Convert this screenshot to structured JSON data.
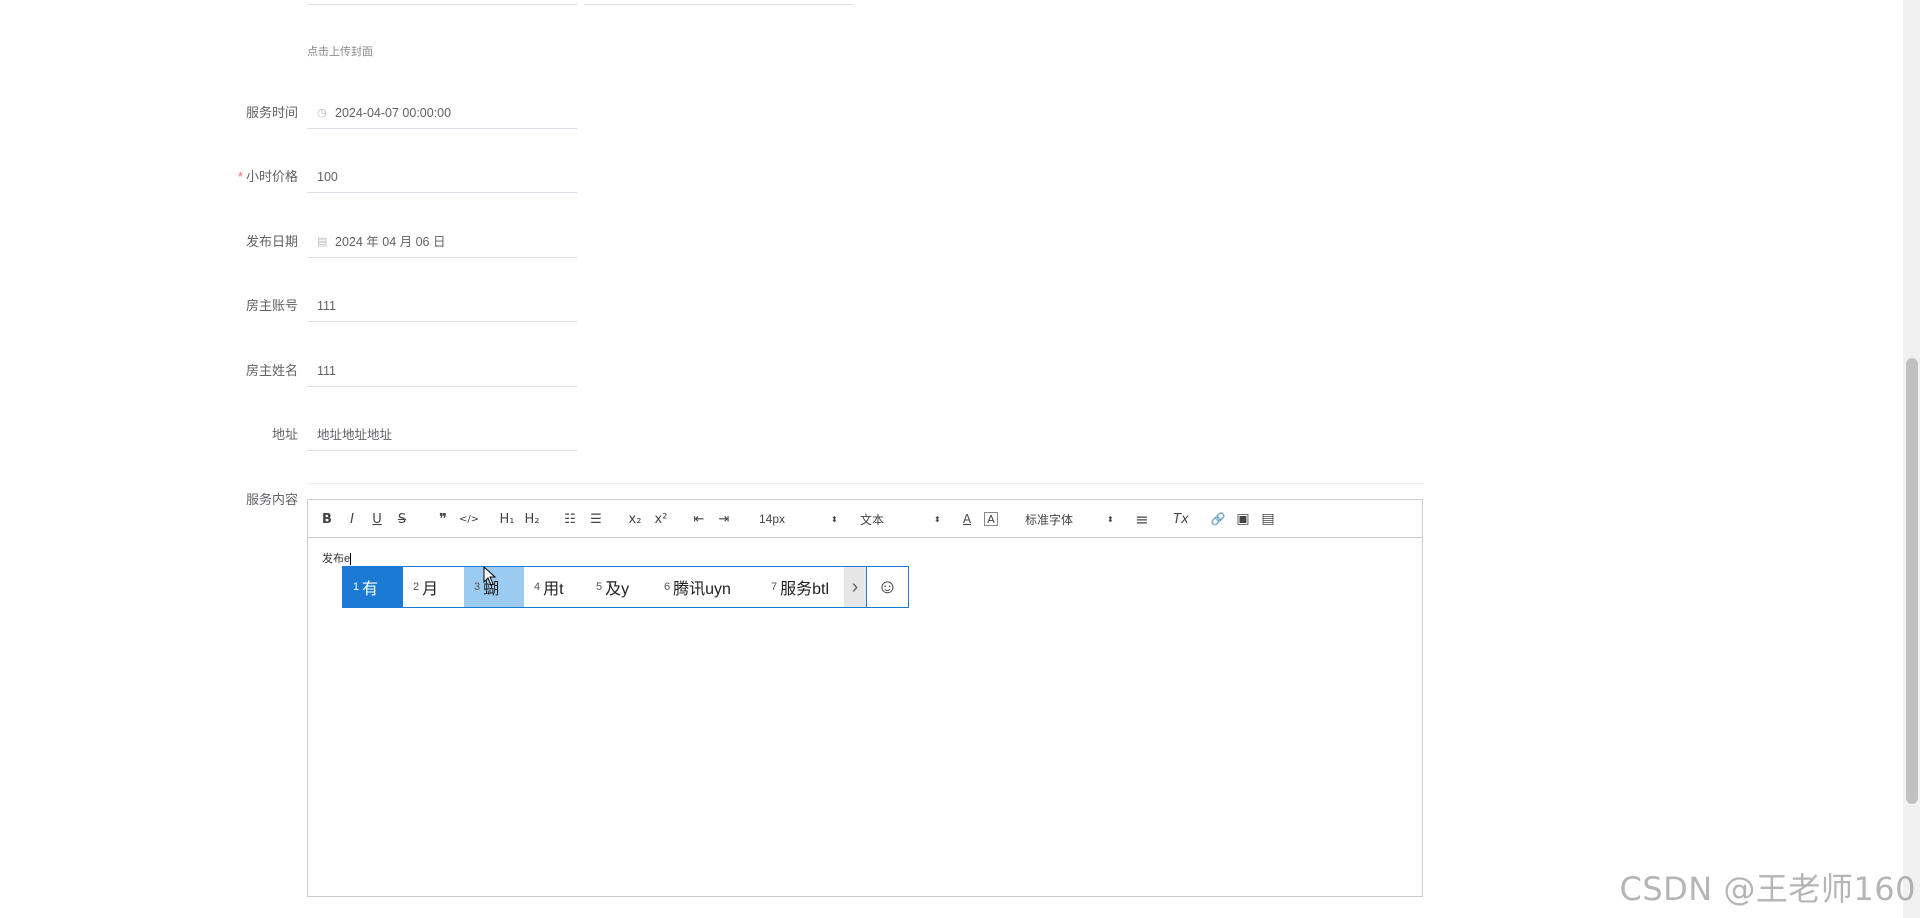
{
  "upload_hint": "点击上传封面",
  "fields": {
    "service_time": {
      "label": "服务时间",
      "value": "2024-04-07 00:00:00",
      "icon": "clock-icon"
    },
    "hourly_price": {
      "label": "小时价格",
      "required_mark": "*",
      "value": "100"
    },
    "publish_date": {
      "label": "发布日期",
      "value": "2024 年 04 月 06 日",
      "icon": "calendar-icon"
    },
    "owner_account": {
      "label": "房主账号",
      "value": "111"
    },
    "owner_name": {
      "label": "房主姓名",
      "value": "111"
    },
    "address": {
      "label": "地址",
      "value": "地址地址地址"
    },
    "service_content": {
      "label": "服务内容"
    }
  },
  "toolbar": {
    "bold": "B",
    "italic": "I",
    "underline": "U",
    "strike": "S",
    "blockquote": "❞",
    "code": "</>",
    "h1": "H₁",
    "h2": "H₂",
    "ordered_list": "☷",
    "bullet_list": "☰",
    "subscript": "x₂",
    "superscript": "x²",
    "outdent": "⇤",
    "indent": "⇥",
    "size_select": "14px",
    "header_select": "文本",
    "font_select": "标准字体",
    "color": "A",
    "background": "A",
    "align": "≡",
    "clean": "Tx",
    "link": "🔗",
    "image": "▣",
    "video": "▤"
  },
  "editor": {
    "content": "发布e"
  },
  "ime": {
    "candidates": [
      {
        "num": "1",
        "text": "有"
      },
      {
        "num": "2",
        "text": "月"
      },
      {
        "num": "3",
        "text": "蝴"
      },
      {
        "num": "4",
        "text": "用t"
      },
      {
        "num": "5",
        "text": "及y"
      },
      {
        "num": "6",
        "text": "腾讯uyn"
      },
      {
        "num": "7",
        "text": "服务btl"
      }
    ],
    "more_icon": "›",
    "emoji_icon": "☺"
  },
  "watermark": "CSDN @王老师160"
}
